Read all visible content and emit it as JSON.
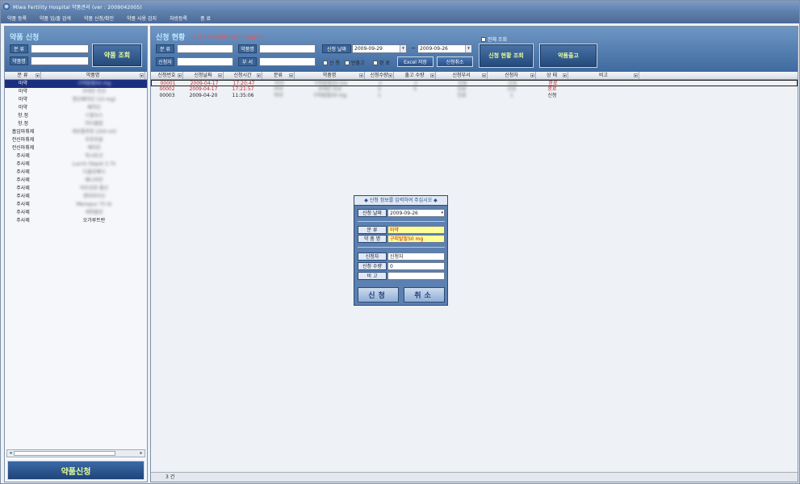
{
  "window": {
    "title": "Miwa Fertility Hospital 약품관리 (ver : 2009042005)"
  },
  "menu": [
    "약품 등록",
    "약품 입/출 검색",
    "약품 신청/확인",
    "약품 사용 검지",
    "처방등록",
    "종 료"
  ],
  "left": {
    "title": "약품 신청",
    "labels": {
      "category": "분 류",
      "drug": "약품명"
    },
    "inputs": {
      "category": "",
      "drug": ""
    },
    "search_button": "약품 조회",
    "columns": [
      "분 류",
      "약품명"
    ],
    "rows": [
      {
        "category": "마약",
        "drug": "구피탈필50 mg"
      },
      {
        "category": "마약",
        "drug": "코데인 인산"
      },
      {
        "category": "마약",
        "drug": "염산페치딘 (10 mg)"
      },
      {
        "category": "마약",
        "drug": "페치딘"
      },
      {
        "category": "항.정",
        "drug": "스틸녹스"
      },
      {
        "category": "항.정",
        "drug": "미다졸람"
      },
      {
        "category": "흡입마취제",
        "drug": "세보플루란 (250 ml)"
      },
      {
        "category": "전신마취제",
        "drug": "프로포폴"
      },
      {
        "category": "전신마취제",
        "drug": "케타민"
      },
      {
        "category": "주사제",
        "drug": "옥시토신"
      },
      {
        "category": "주사제",
        "drug": "Lucrin Depot 3.75"
      },
      {
        "category": "주사제",
        "drug": "디클로페낙"
      },
      {
        "category": "주사제",
        "drug": "페니라민"
      },
      {
        "category": "주사제",
        "drug": "아트로핀 황산"
      },
      {
        "category": "주사제",
        "drug": "겐타마이신"
      },
      {
        "category": "주사제",
        "drug": "Menopur 75 IU"
      },
      {
        "category": "주사제",
        "drug": "세파졸린"
      },
      {
        "category": "주사제",
        "drug": "오가루트란"
      }
    ],
    "apply_button": "약품신청"
  },
  "right": {
    "title": "신청 현황",
    "warning": "7 개의 약품신청이 접수 되었습니다",
    "labels": {
      "category": "분 류",
      "drug": "약품명",
      "applicant": "신청자",
      "dept": "부 서",
      "date": "신청 날짜"
    },
    "inputs": {
      "category": "",
      "drug": "",
      "applicant": "",
      "dept": ""
    },
    "date_from": "2009-09-29",
    "date_to": "2009-09-26",
    "date_separator": "~",
    "checkboxes": {
      "apply": "신 청",
      "out": "반출고",
      "done": "완 료",
      "all": "전체 조회"
    },
    "excel_button": "Excel 저장",
    "cancel_button": "신청취소",
    "search_button": "신청 현황 조회",
    "release_button": "약품출고",
    "columns": [
      "신청번호",
      "신청날짜",
      "신청시간",
      "분류",
      "약품명",
      "신청수량",
      "출고 수량",
      "신청부서",
      "신청자",
      "상 태",
      "비고"
    ],
    "rows": [
      {
        "no": "00001",
        "date": "2009-04-17",
        "time": "17:20:47",
        "category": "마약",
        "drug": "구피탈필50 mg",
        "qty": "2",
        "out": "2",
        "dept": "진료",
        "applicant": "간호",
        "status": "완료"
      },
      {
        "no": "00002",
        "date": "2009-04-17",
        "time": "17:21:57",
        "category": "마약",
        "drug": "코데인 인산",
        "qty": "5",
        "out": "5",
        "dept": "진료",
        "applicant": "간호",
        "status": "완료"
      },
      {
        "no": "00003",
        "date": "2009-04-20",
        "time": "11:35:06",
        "category": "마약",
        "drug": "구피탈필50 mg",
        "qty": "1",
        "out": "",
        "dept": "진료",
        "applicant": "1",
        "status": "신청"
      }
    ],
    "count": "3 건"
  },
  "dialog": {
    "title": "◆ 신청 정보를 입력하여 주십시오 ◆",
    "date_label": "신청 날짜",
    "date_value": "2009-09-26",
    "category_label": "분 류",
    "category_value": "마약",
    "drug_label": "약 품 명",
    "drug_value": "구피탈필50 mg",
    "applicant_label": "신청자",
    "applicant_value": "신청자",
    "qty_label": "신청 수량",
    "qty_value": "0",
    "note_label": "비 고",
    "note_value": "",
    "ok_button": "신청",
    "cancel_button": "취소"
  }
}
